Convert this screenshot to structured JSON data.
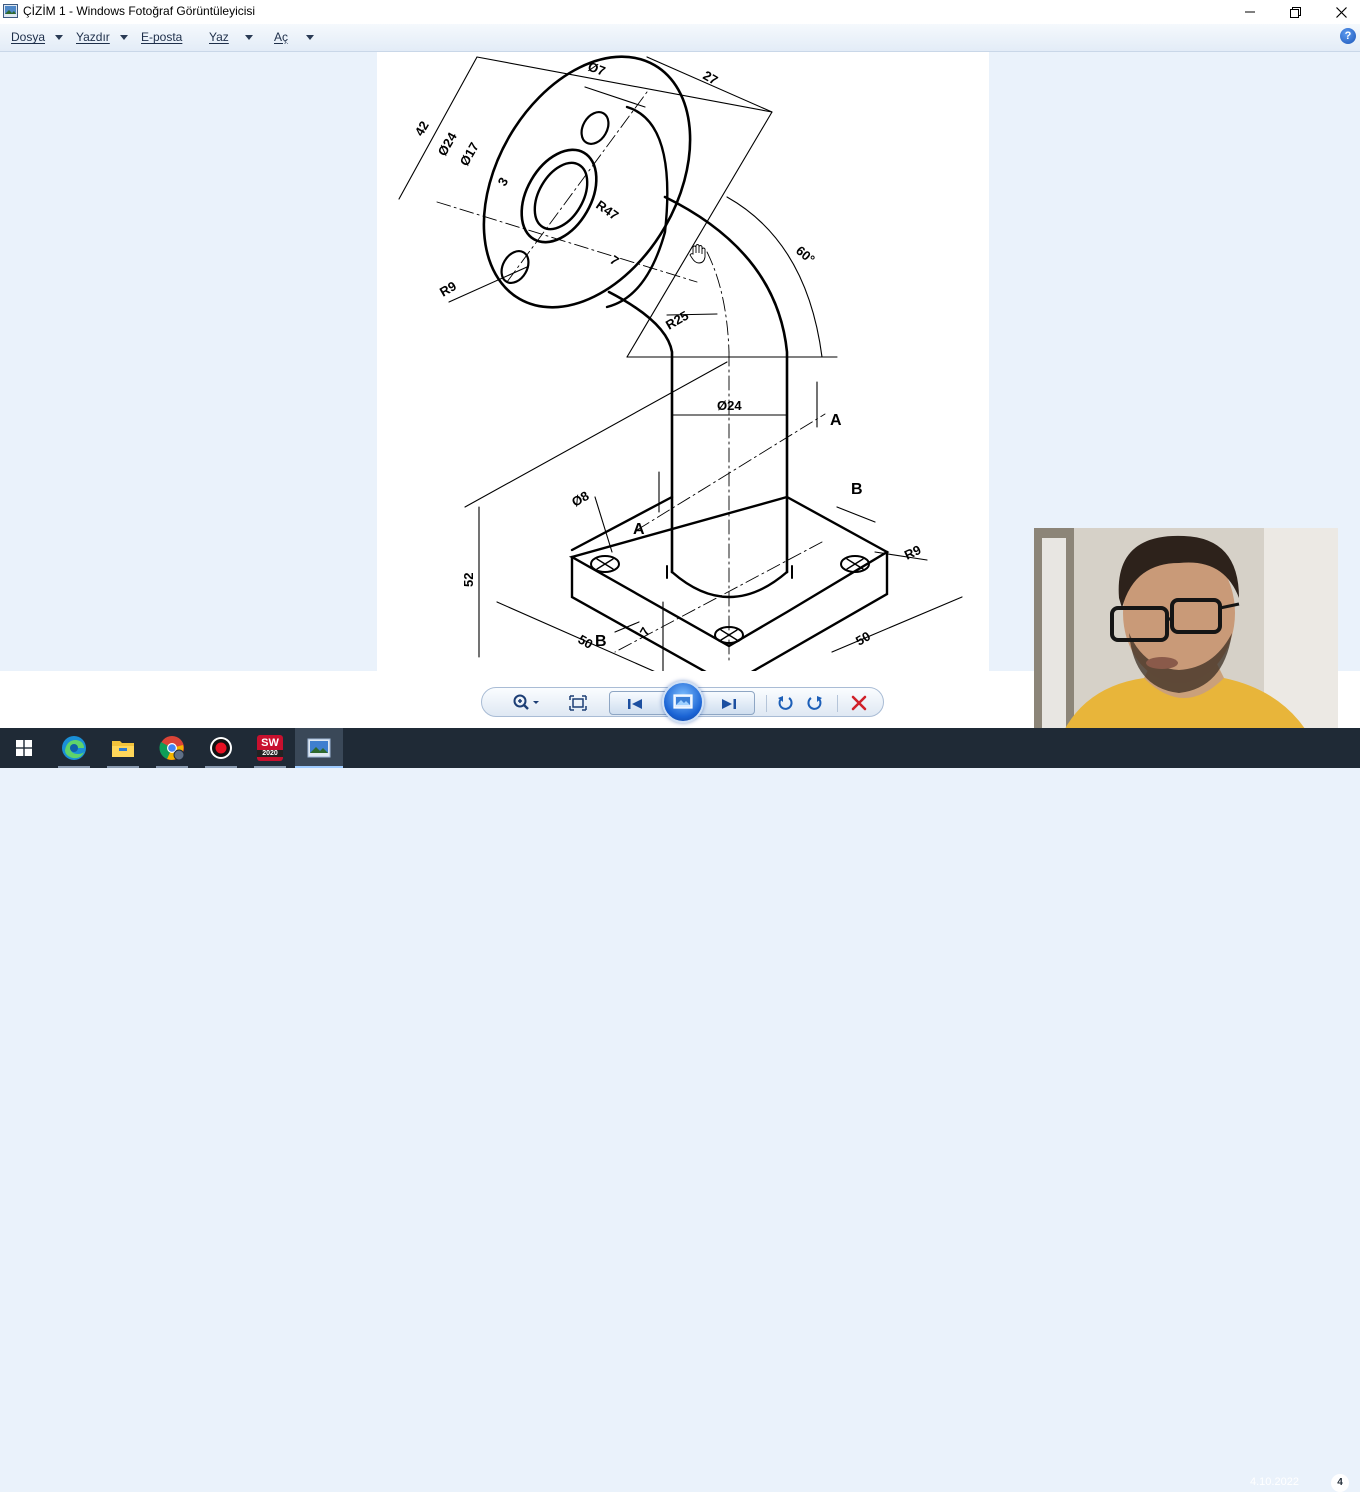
{
  "window": {
    "title": "ÇİZİM 1 - Windows Fotoğraf Görüntüleyicisi",
    "icon": "photo-viewer-icon"
  },
  "menu": {
    "items": [
      {
        "label": "Dosya"
      },
      {
        "label": "Yazdır"
      },
      {
        "label": "E-posta"
      },
      {
        "label": "Yaz"
      },
      {
        "label": "Aç"
      }
    ],
    "help_label": "?"
  },
  "drawing": {
    "labels": {
      "d7": "Ø7",
      "d27": "27",
      "d42": "42",
      "d24a": "Ø24",
      "d17": "Ø17",
      "d3": "3",
      "r47": "R47",
      "d7b": "7",
      "r9a": "R9",
      "r25": "R25",
      "a60": "60°",
      "d24b": "Ø24",
      "secA1": "A",
      "secA2": "A",
      "secB1": "B",
      "secB2": "B",
      "d8": "Ø8",
      "r9b": "R9",
      "d52": "52",
      "d50a": "50",
      "d50b": "50",
      "d7c": "7"
    }
  },
  "toolbar": {
    "icons": [
      "zoom-icon",
      "fit-window-icon",
      "previous-icon",
      "slideshow-icon",
      "next-icon",
      "rotate-left-icon",
      "rotate-right-icon",
      "delete-icon"
    ]
  },
  "taskbar": {
    "apps": [
      "windows-start-icon",
      "edge-icon",
      "file-explorer-icon",
      "chrome-icon",
      "record-icon",
      "solidworks-icon",
      "photo-viewer-icon"
    ],
    "solidworks_label": "SW",
    "solidworks_year": "2020",
    "clock": "4.10.2022",
    "notifications": "4"
  },
  "colors": {
    "accent": "#1a63d4",
    "delete": "#d0212a",
    "taskbar": "#1f2a36"
  }
}
